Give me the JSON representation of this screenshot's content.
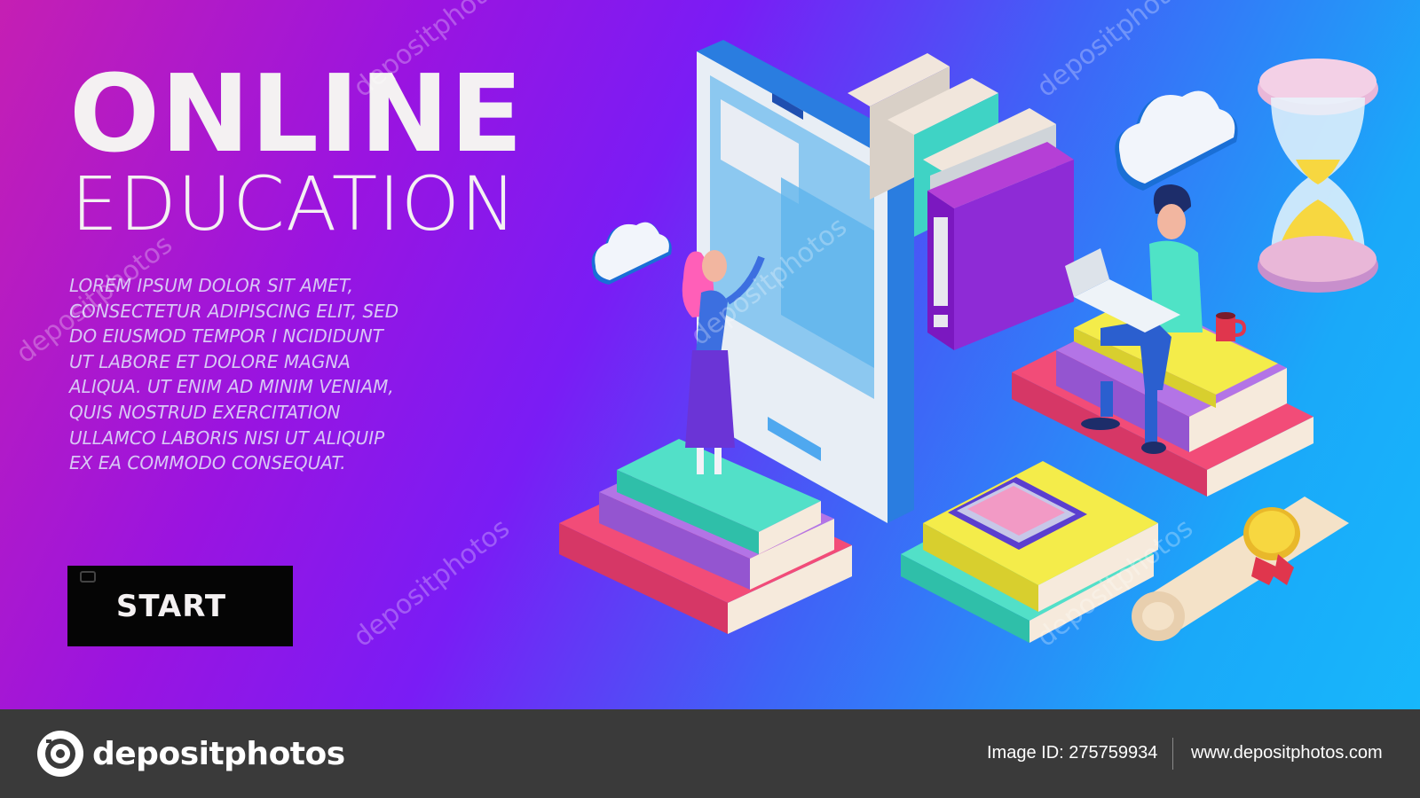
{
  "hero": {
    "title_line1": "ONLINE",
    "title_line2": "EDUCATION",
    "body": "LOREM IPSUM DOLOR SIT AMET, CONSECTETUR ADIPISCING ELIT, SED DO EIUSMOD TEMPOR I NCIDIDUNT UT LABORE ET DOLORE MAGNA ALIQUA. UT ENIM AD MINIM VENIAM, QUIS NOSTRUD EXERCITATION ULLAMCO LABORIS NISI UT ALIQUIP EX EA COMMODO CONSEQUAT.",
    "start_label": "START"
  },
  "watermark": {
    "text": "depositphotos"
  },
  "footer": {
    "logo_text": "depositphotos",
    "image_id": "Image ID: 275759934",
    "site_url": "www.depositphotos.com"
  },
  "colors": {
    "gradient_start": "#c51fb3",
    "gradient_mid": "#7a1cf5",
    "gradient_end": "#17b7fb",
    "button_bg": "#050505",
    "footer_bg": "#3a3a3a",
    "title_color": "#f4f1f2"
  },
  "icons": [
    "camera-logo-icon",
    "cloud-icon",
    "hourglass-icon",
    "calculator-icon",
    "phone-icon",
    "book-stack-icon",
    "binder-icon",
    "scroll-diploma-icon",
    "coffee-mug-icon",
    "laptop-icon"
  ]
}
